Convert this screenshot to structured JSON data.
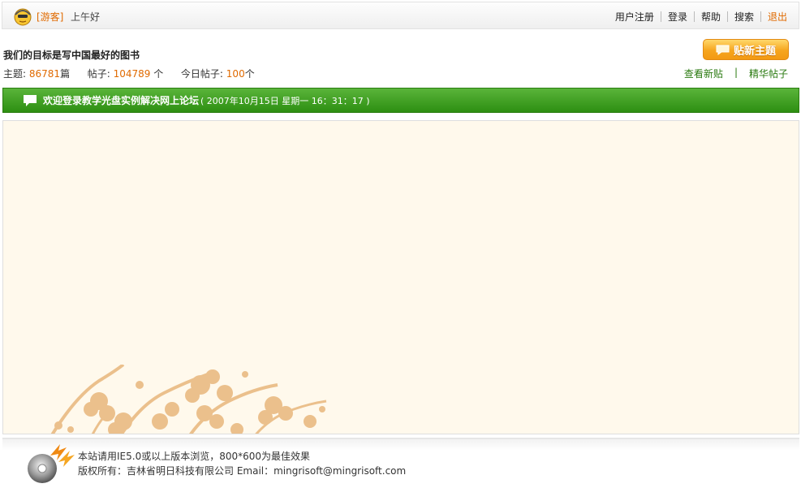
{
  "topbar": {
    "guest_label": "[游客]",
    "greeting": "上午好",
    "nav": [
      "用户注册",
      "登录",
      "帮助",
      "搜索",
      "退出"
    ]
  },
  "header": {
    "slogan": "我们的目标是写中国最好的图书",
    "stats": {
      "topics_label": "主题:",
      "topics_value": "86781",
      "topics_unit": "篇",
      "posts_label": "帖子:",
      "posts_value": "104789",
      "posts_unit": "个",
      "today_label": "今日帖子:",
      "today_value": "100",
      "today_unit": "个"
    },
    "new_topic_button": "贴新主题",
    "links": [
      "查看新贴",
      "精华帖子"
    ],
    "links_separator": "|"
  },
  "welcome": {
    "text": "欢迎登录教学光盘实例解决网上论坛",
    "datetime": "( 2007年10月15日 星期一 16：31：17 )"
  },
  "footer": {
    "line1": "本站请用IE5.0或以上版本浏览，800*600为最佳效果",
    "line2": "版权所有：吉林省明日科技有限公司 Email：mingrisoft@mingrisoft.com"
  },
  "colors": {
    "accent_orange": "#e06a00",
    "link_green": "#2a7a10",
    "banner_green": "#2d8f12",
    "content_bg": "#fff9ec"
  },
  "icons": [
    "user-avatar-icon",
    "speech-bubble-icon",
    "chat-icon",
    "cd-disc-logo-icon",
    "plum-blossom-decoration"
  ]
}
